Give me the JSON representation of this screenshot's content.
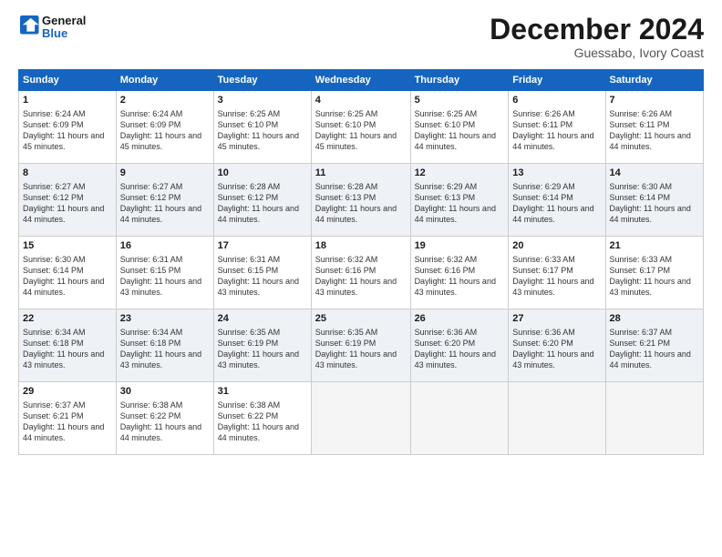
{
  "logo": {
    "line1": "General",
    "line2": "Blue"
  },
  "title": "December 2024",
  "location": "Guessabo, Ivory Coast",
  "days_of_week": [
    "Sunday",
    "Monday",
    "Tuesday",
    "Wednesday",
    "Thursday",
    "Friday",
    "Saturday"
  ],
  "weeks": [
    [
      {
        "day": "1",
        "sunrise": "6:24 AM",
        "sunset": "6:09 PM",
        "daylight": "11 hours and 45 minutes."
      },
      {
        "day": "2",
        "sunrise": "6:24 AM",
        "sunset": "6:09 PM",
        "daylight": "11 hours and 45 minutes."
      },
      {
        "day": "3",
        "sunrise": "6:25 AM",
        "sunset": "6:10 PM",
        "daylight": "11 hours and 45 minutes."
      },
      {
        "day": "4",
        "sunrise": "6:25 AM",
        "sunset": "6:10 PM",
        "daylight": "11 hours and 45 minutes."
      },
      {
        "day": "5",
        "sunrise": "6:25 AM",
        "sunset": "6:10 PM",
        "daylight": "11 hours and 44 minutes."
      },
      {
        "day": "6",
        "sunrise": "6:26 AM",
        "sunset": "6:11 PM",
        "daylight": "11 hours and 44 minutes."
      },
      {
        "day": "7",
        "sunrise": "6:26 AM",
        "sunset": "6:11 PM",
        "daylight": "11 hours and 44 minutes."
      }
    ],
    [
      {
        "day": "8",
        "sunrise": "6:27 AM",
        "sunset": "6:12 PM",
        "daylight": "11 hours and 44 minutes."
      },
      {
        "day": "9",
        "sunrise": "6:27 AM",
        "sunset": "6:12 PM",
        "daylight": "11 hours and 44 minutes."
      },
      {
        "day": "10",
        "sunrise": "6:28 AM",
        "sunset": "6:12 PM",
        "daylight": "11 hours and 44 minutes."
      },
      {
        "day": "11",
        "sunrise": "6:28 AM",
        "sunset": "6:13 PM",
        "daylight": "11 hours and 44 minutes."
      },
      {
        "day": "12",
        "sunrise": "6:29 AM",
        "sunset": "6:13 PM",
        "daylight": "11 hours and 44 minutes."
      },
      {
        "day": "13",
        "sunrise": "6:29 AM",
        "sunset": "6:14 PM",
        "daylight": "11 hours and 44 minutes."
      },
      {
        "day": "14",
        "sunrise": "6:30 AM",
        "sunset": "6:14 PM",
        "daylight": "11 hours and 44 minutes."
      }
    ],
    [
      {
        "day": "15",
        "sunrise": "6:30 AM",
        "sunset": "6:14 PM",
        "daylight": "11 hours and 44 minutes."
      },
      {
        "day": "16",
        "sunrise": "6:31 AM",
        "sunset": "6:15 PM",
        "daylight": "11 hours and 43 minutes."
      },
      {
        "day": "17",
        "sunrise": "6:31 AM",
        "sunset": "6:15 PM",
        "daylight": "11 hours and 43 minutes."
      },
      {
        "day": "18",
        "sunrise": "6:32 AM",
        "sunset": "6:16 PM",
        "daylight": "11 hours and 43 minutes."
      },
      {
        "day": "19",
        "sunrise": "6:32 AM",
        "sunset": "6:16 PM",
        "daylight": "11 hours and 43 minutes."
      },
      {
        "day": "20",
        "sunrise": "6:33 AM",
        "sunset": "6:17 PM",
        "daylight": "11 hours and 43 minutes."
      },
      {
        "day": "21",
        "sunrise": "6:33 AM",
        "sunset": "6:17 PM",
        "daylight": "11 hours and 43 minutes."
      }
    ],
    [
      {
        "day": "22",
        "sunrise": "6:34 AM",
        "sunset": "6:18 PM",
        "daylight": "11 hours and 43 minutes."
      },
      {
        "day": "23",
        "sunrise": "6:34 AM",
        "sunset": "6:18 PM",
        "daylight": "11 hours and 43 minutes."
      },
      {
        "day": "24",
        "sunrise": "6:35 AM",
        "sunset": "6:19 PM",
        "daylight": "11 hours and 43 minutes."
      },
      {
        "day": "25",
        "sunrise": "6:35 AM",
        "sunset": "6:19 PM",
        "daylight": "11 hours and 43 minutes."
      },
      {
        "day": "26",
        "sunrise": "6:36 AM",
        "sunset": "6:20 PM",
        "daylight": "11 hours and 43 minutes."
      },
      {
        "day": "27",
        "sunrise": "6:36 AM",
        "sunset": "6:20 PM",
        "daylight": "11 hours and 43 minutes."
      },
      {
        "day": "28",
        "sunrise": "6:37 AM",
        "sunset": "6:21 PM",
        "daylight": "11 hours and 44 minutes."
      }
    ],
    [
      {
        "day": "29",
        "sunrise": "6:37 AM",
        "sunset": "6:21 PM",
        "daylight": "11 hours and 44 minutes."
      },
      {
        "day": "30",
        "sunrise": "6:38 AM",
        "sunset": "6:22 PM",
        "daylight": "11 hours and 44 minutes."
      },
      {
        "day": "31",
        "sunrise": "6:38 AM",
        "sunset": "6:22 PM",
        "daylight": "11 hours and 44 minutes."
      },
      null,
      null,
      null,
      null
    ]
  ]
}
